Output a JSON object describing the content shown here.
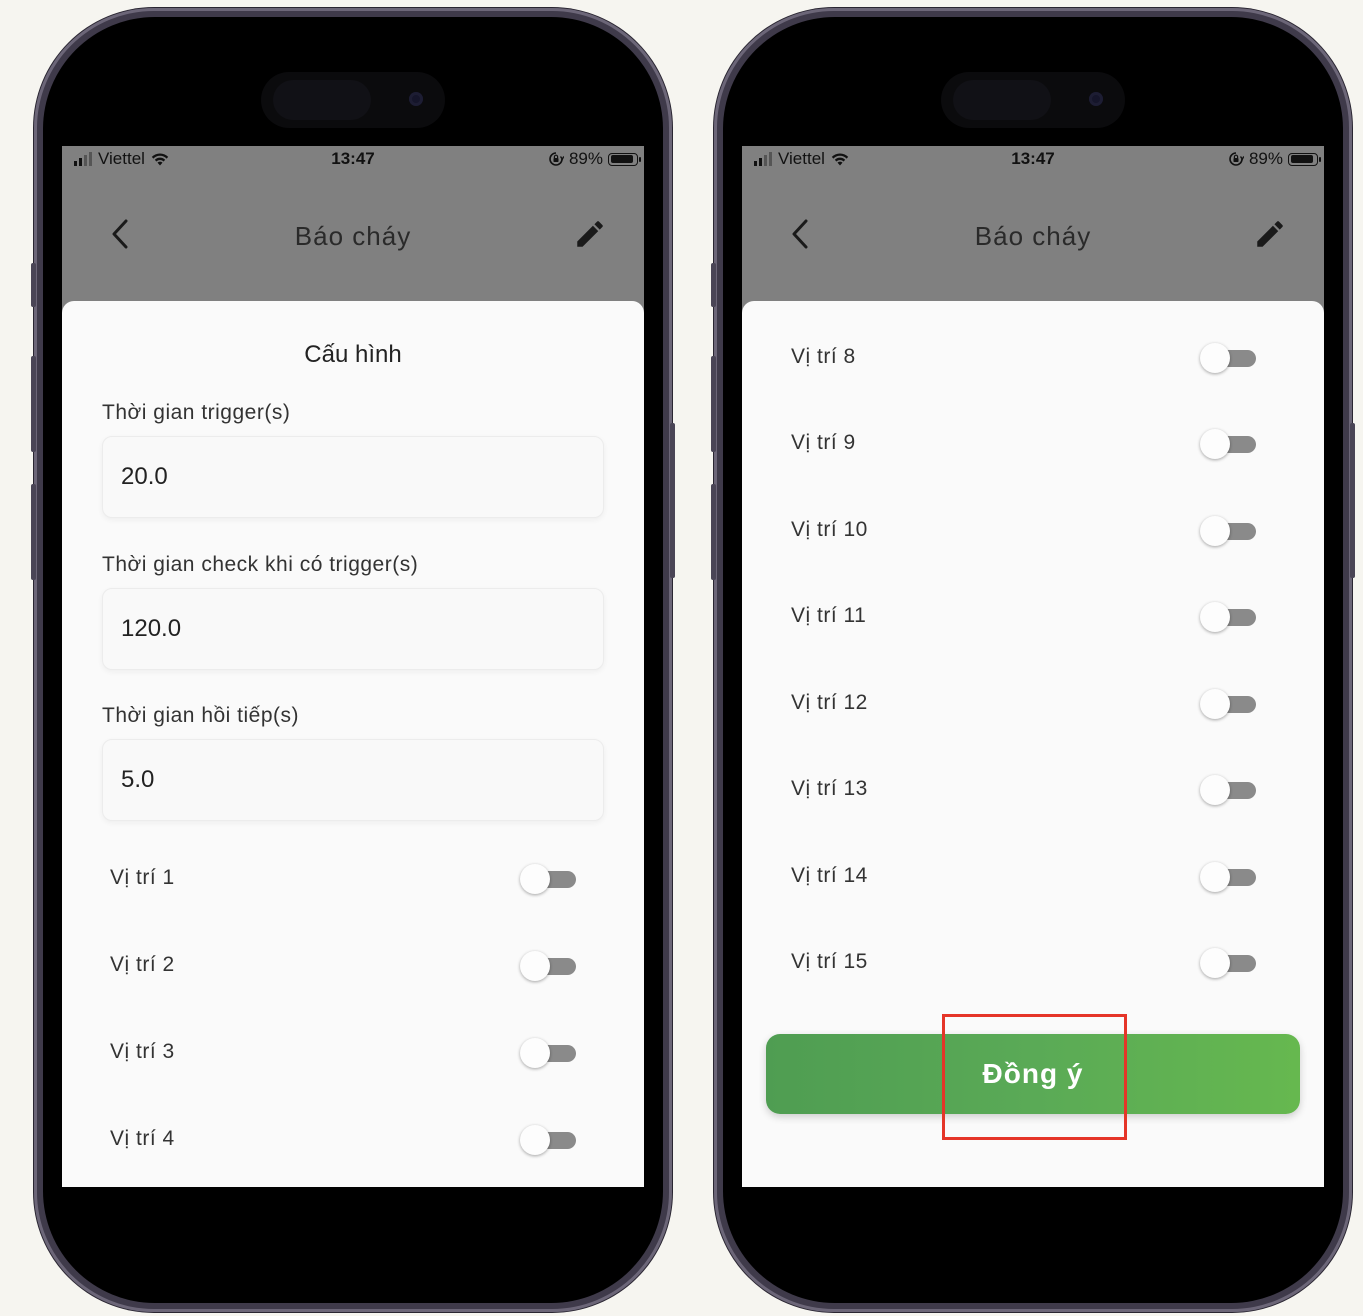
{
  "status_bar": {
    "carrier": "Viettel",
    "time": "13:47",
    "battery_text": "89%",
    "battery_level": 0.89
  },
  "nav": {
    "title": "Báo cháy"
  },
  "left_screen": {
    "sheet_title": "Cấu hình",
    "fields": [
      {
        "label": "Thời gian trigger(s)",
        "value": "20.0"
      },
      {
        "label": "Thời gian check khi có trigger(s)",
        "value": "120.0"
      },
      {
        "label": "Thời gian hồi tiếp(s)",
        "value": "5.0"
      }
    ],
    "positions": [
      {
        "label": "Vị trí 1",
        "on": false
      },
      {
        "label": "Vị trí 2",
        "on": false
      },
      {
        "label": "Vị trí 3",
        "on": false
      },
      {
        "label": "Vị trí 4",
        "on": false
      }
    ]
  },
  "right_screen": {
    "positions": [
      {
        "label": "Vị trí 8",
        "on": false
      },
      {
        "label": "Vị trí 9",
        "on": false
      },
      {
        "label": "Vị trí 10",
        "on": false
      },
      {
        "label": "Vị trí 11",
        "on": false
      },
      {
        "label": "Vị trí 12",
        "on": false
      },
      {
        "label": "Vị trí 13",
        "on": false
      },
      {
        "label": "Vị trí 14",
        "on": false
      },
      {
        "label": "Vị trí 15",
        "on": false
      }
    ],
    "confirm_label": "Đồng ý"
  },
  "colors": {
    "accent_green": "#5aaa56",
    "highlight_red": "#e53528",
    "overlay_gray": "#808080"
  }
}
